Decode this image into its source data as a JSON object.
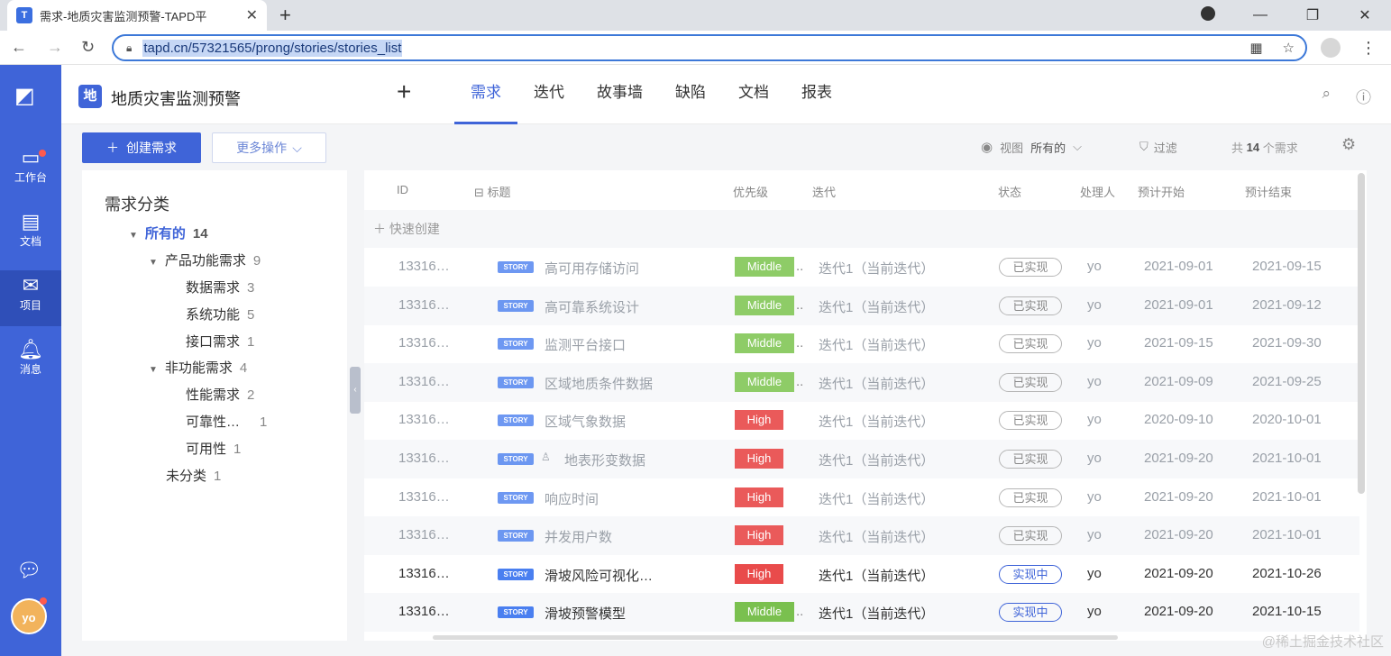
{
  "browser": {
    "tab_title": "需求-地质灾害监测预警-TAPD平",
    "favicon": "T",
    "url": "tapd.cn/57321565/prong/stories/stories_list"
  },
  "rail": {
    "items": [
      {
        "label": "工作台",
        "icon": "workbench-icon"
      },
      {
        "label": "文档",
        "icon": "doc-icon"
      },
      {
        "label": "项目",
        "icon": "project-icon"
      },
      {
        "label": "消息",
        "icon": "bell-icon"
      }
    ],
    "avatar": "yo"
  },
  "header": {
    "project_badge": "地",
    "project_name": "地质灾害监测预警",
    "tabs": [
      "需求",
      "迭代",
      "故事墙",
      "缺陷",
      "文档",
      "报表"
    ],
    "active_tab": "需求"
  },
  "toolbar": {
    "create_label": "创建需求",
    "more_label": "更多操作",
    "view_label": "视图",
    "view_value": "所有的",
    "filter_label": "过滤",
    "count_prefix": "共",
    "count": "14",
    "count_suffix": "个需求"
  },
  "categories": {
    "title": "需求分类",
    "nodes": [
      {
        "label": "所有的",
        "count": "14"
      },
      {
        "label": "产品功能需求",
        "count": "9"
      },
      {
        "label": "数据需求",
        "count": "3"
      },
      {
        "label": "系统功能",
        "count": "5"
      },
      {
        "label": "接口需求",
        "count": "1"
      },
      {
        "label": "非功能需求",
        "count": "4"
      },
      {
        "label": "性能需求",
        "count": "2"
      },
      {
        "label": "可靠性…",
        "count": "1"
      },
      {
        "label": "可用性",
        "count": "1"
      },
      {
        "label": "未分类",
        "count": "1"
      }
    ]
  },
  "table": {
    "headers": {
      "id": "ID",
      "title": "标题",
      "priority": "优先级",
      "iteration": "迭代",
      "status": "状态",
      "owner": "处理人",
      "start": "预计开始",
      "end": "预计结束"
    },
    "quick_create": "快速创建",
    "story_tag": "STORY",
    "rows": [
      {
        "id": "13316…",
        "title": "高可用存储访问",
        "priority": "Middle",
        "iteration": "迭代1（当前迭代）",
        "status": "已实现",
        "owner": "yo",
        "start": "2021-09-01",
        "end": "2021-09-15"
      },
      {
        "id": "13316…",
        "title": "高可靠系统设计",
        "priority": "Middle",
        "iteration": "迭代1（当前迭代）",
        "status": "已实现",
        "owner": "yo",
        "start": "2021-09-01",
        "end": "2021-09-12"
      },
      {
        "id": "13316…",
        "title": "监测平台接口",
        "priority": "Middle",
        "iteration": "迭代1（当前迭代）",
        "status": "已实现",
        "owner": "yo",
        "start": "2021-09-15",
        "end": "2021-09-30"
      },
      {
        "id": "13316…",
        "title": "区域地质条件数据",
        "priority": "Middle",
        "iteration": "迭代1（当前迭代）",
        "status": "已实现",
        "owner": "yo",
        "start": "2021-09-09",
        "end": "2021-09-25"
      },
      {
        "id": "13316…",
        "title": "区域气象数据",
        "priority": "High",
        "iteration": "迭代1（当前迭代）",
        "status": "已实现",
        "owner": "yo",
        "start": "2020-09-10",
        "end": "2020-10-01"
      },
      {
        "id": "13316…",
        "title": "地表形变数据",
        "priority": "High",
        "iteration": "迭代1（当前迭代）",
        "status": "已实现",
        "owner": "yo",
        "start": "2021-09-20",
        "end": "2021-10-01"
      },
      {
        "id": "13316…",
        "title": "响应时间",
        "priority": "High",
        "iteration": "迭代1（当前迭代）",
        "status": "已实现",
        "owner": "yo",
        "start": "2021-09-20",
        "end": "2021-10-01"
      },
      {
        "id": "13316…",
        "title": "并发用户数",
        "priority": "High",
        "iteration": "迭代1（当前迭代）",
        "status": "已实现",
        "owner": "yo",
        "start": "2021-09-20",
        "end": "2021-10-01"
      },
      {
        "id": "13316…",
        "title": "滑坡风险可视化…",
        "priority": "High",
        "iteration": "迭代1（当前迭代）",
        "status": "实现中",
        "owner": "yo",
        "start": "2021-09-20",
        "end": "2021-10-26"
      },
      {
        "id": "13316…",
        "title": "滑坡预警模型",
        "priority": "Middle",
        "iteration": "迭代1（当前迭代）",
        "status": "实现中",
        "owner": "yo",
        "start": "2021-09-20",
        "end": "2021-10-15"
      }
    ]
  },
  "watermark": "@稀土掘金技术社区",
  "colors": {
    "brand": "#3f64d8",
    "middle": "#7ac04f",
    "high": "#e94b4b"
  }
}
